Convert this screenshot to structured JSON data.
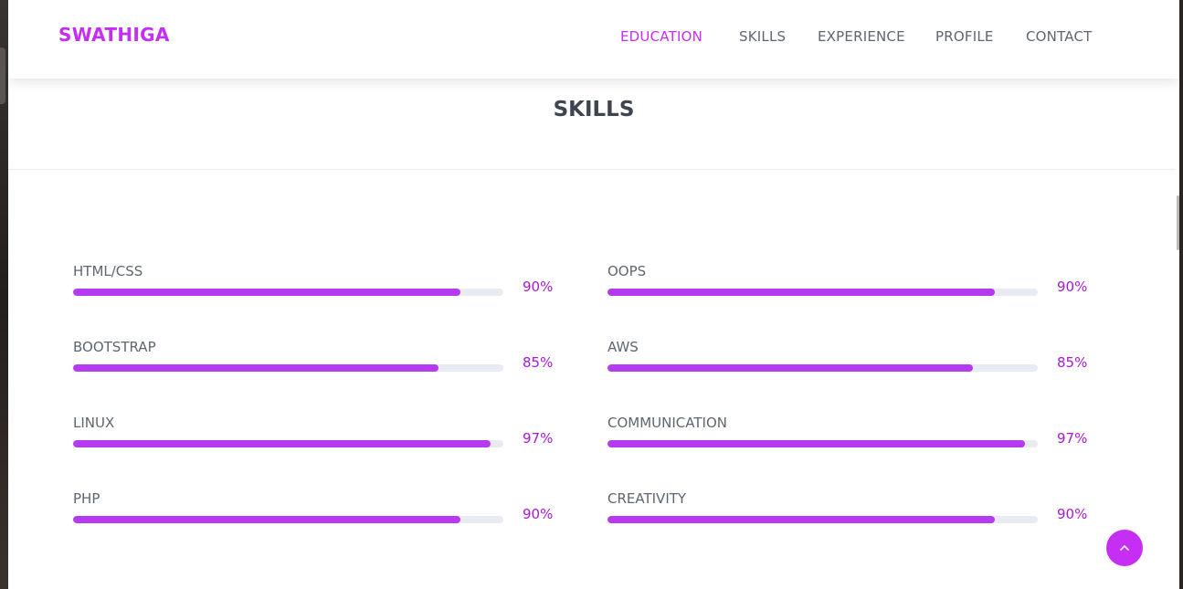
{
  "brand": {
    "name": "SWATHIGA",
    "accent": "#c72ef3",
    "bar_color": "#b53af0"
  },
  "nav": {
    "items": [
      {
        "label": "EDUCATION",
        "active": true
      },
      {
        "label": "SKILLS",
        "active": false
      },
      {
        "label": "EXPERIENCE",
        "active": false
      },
      {
        "label": "PROFILE",
        "active": false
      },
      {
        "label": "CONTACT",
        "active": false
      }
    ]
  },
  "section": {
    "title": "SKILLS"
  },
  "skills": [
    {
      "name": "HTML/CSS",
      "value": 90,
      "label": "90%"
    },
    {
      "name": "BOOTSTRAP",
      "value": 85,
      "label": "85%"
    },
    {
      "name": "LINUX",
      "value": 97,
      "label": "97%"
    },
    {
      "name": "PHP",
      "value": 90,
      "label": "90%"
    },
    {
      "name": "OOPS",
      "value": 90,
      "label": "90%"
    },
    {
      "name": "AWS",
      "value": 85,
      "label": "85%"
    },
    {
      "name": "COMMUNICATION",
      "value": 97,
      "label": "97%"
    },
    {
      "name": "CREATIVITY",
      "value": 90,
      "label": "90%"
    }
  ],
  "back_to_top": {
    "icon": "chevron-up-icon"
  }
}
